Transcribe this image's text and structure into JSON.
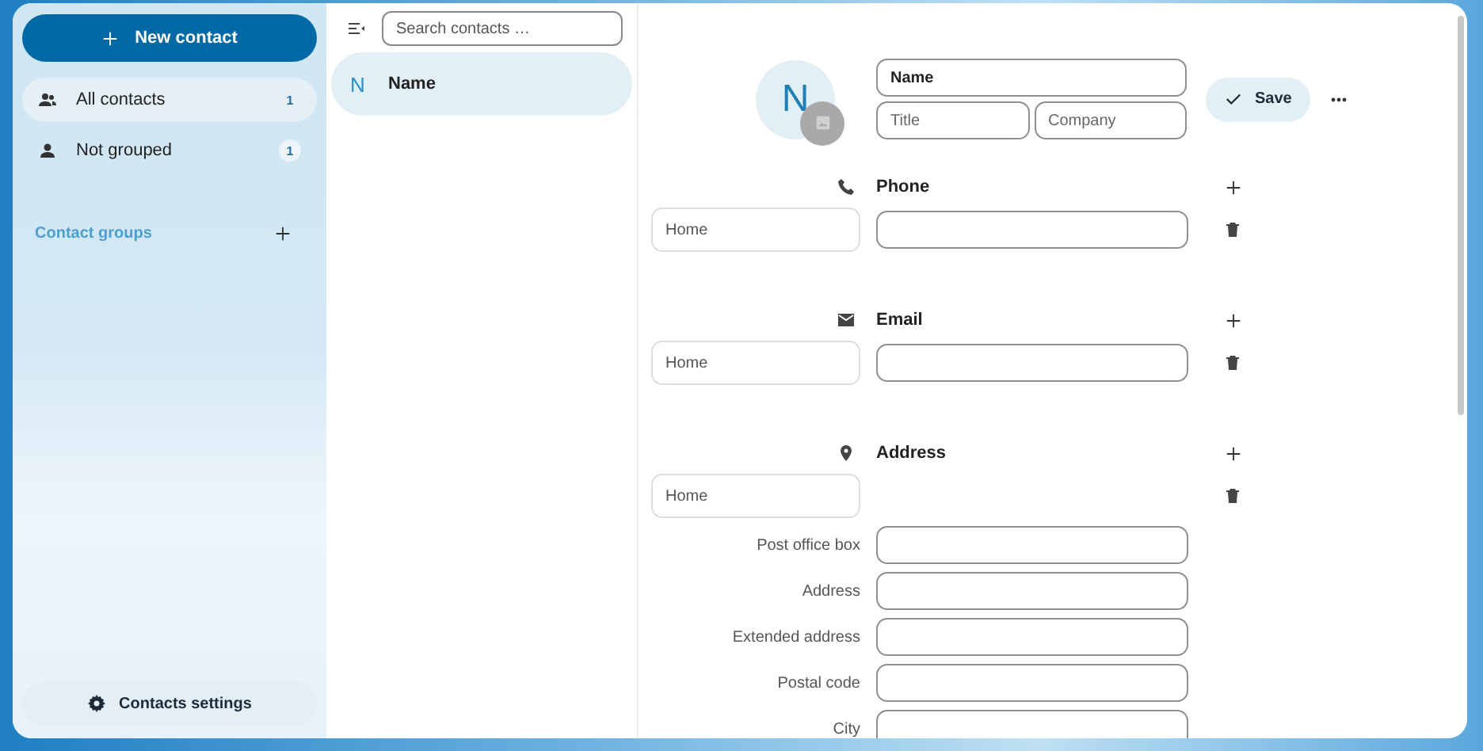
{
  "sidebar": {
    "new_button": "New contact",
    "items": [
      {
        "label": "All contacts",
        "count": "1",
        "kind": "group",
        "selected": true
      },
      {
        "label": "Not grouped",
        "count": "1",
        "kind": "person",
        "selected": false
      }
    ],
    "groups_heading": "Contact groups",
    "settings": "Contacts settings"
  },
  "list": {
    "search": {
      "placeholder": "Search contacts …"
    },
    "contacts": [
      {
        "initial": "N",
        "name": "Name",
        "selected": true
      }
    ]
  },
  "details": {
    "avatar_initial": "N",
    "name": "Name",
    "title_placeholder": "Title",
    "company_placeholder": "Company",
    "save_button": "Save",
    "sections": [
      {
        "kind": "phone",
        "title": "Phone",
        "type": "Home"
      },
      {
        "kind": "email",
        "title": "Email",
        "type": "Home"
      },
      {
        "kind": "address",
        "title": "Address",
        "type": "Home",
        "fields": [
          "Post office box",
          "Address",
          "Extended address",
          "Postal code",
          "City"
        ]
      }
    ]
  }
}
